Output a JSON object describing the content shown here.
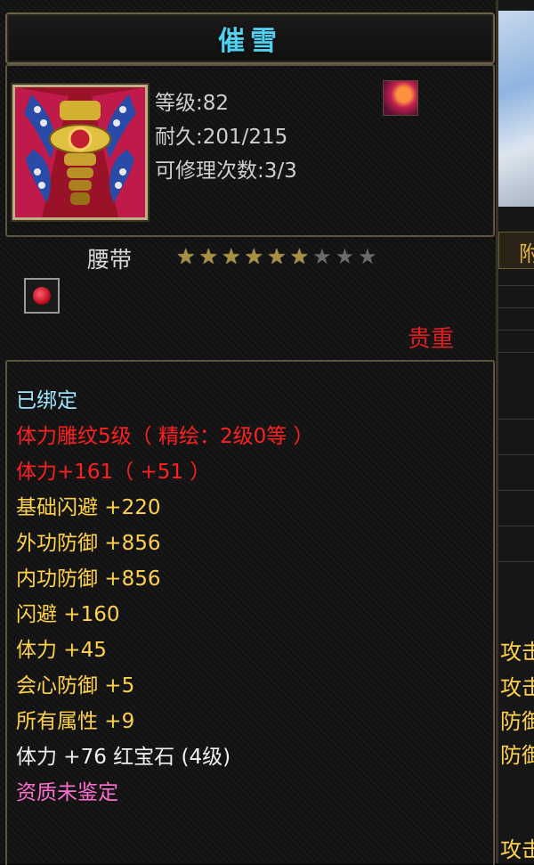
{
  "item": {
    "name": "催雪",
    "level": "等级:82",
    "durability": "耐久:201/215",
    "repairs": "可修理次数:3/3",
    "type": "腰带",
    "rarity": "贵重",
    "stars": {
      "filled": 6,
      "total": 9
    }
  },
  "attributes": [
    {
      "text": "已绑定",
      "color": "cyan"
    },
    {
      "text": "体力雕纹5级（ 精绘：2级0等 ）",
      "color": "red"
    },
    {
      "text": "体力+161（ +51 ）",
      "color": "red"
    },
    {
      "text": "基础闪避  +220",
      "color": "yellow"
    },
    {
      "text": "外功防御  +856",
      "color": "yellow"
    },
    {
      "text": "内功防御  +856",
      "color": "yellow"
    },
    {
      "text": "闪避  +160",
      "color": "yellow"
    },
    {
      "text": "体力  +45",
      "color": "yellow"
    },
    {
      "text": "会心防御  +5",
      "color": "yellow"
    },
    {
      "text": "所有属性  +9",
      "color": "yellow"
    },
    {
      "text": "体力  +76  红宝石 (4级)",
      "color": "white"
    },
    {
      "text": "资质未鉴定",
      "color": "pink"
    }
  ],
  "background": {
    "tab_label": "附",
    "side_labels": [
      "攻击",
      "攻击",
      "防御",
      "防御",
      "攻击"
    ]
  },
  "colors": {
    "title": "#4fd0f0",
    "rarity": "#e02020",
    "attr_yellow": "#ffd24a"
  }
}
